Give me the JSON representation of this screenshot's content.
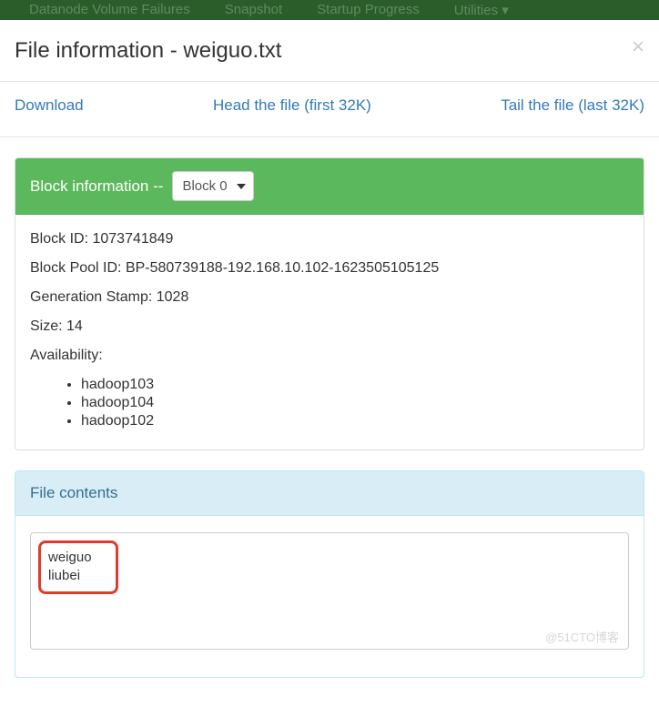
{
  "nav": {
    "items": [
      "Datanode Volume Failures",
      "Snapshot",
      "Startup Progress",
      "Utilities ▾"
    ]
  },
  "modal": {
    "title": "File information - weiguo.txt"
  },
  "actions": {
    "download": "Download",
    "head": "Head the file (first 32K)",
    "tail": "Tail the file (last 32K)"
  },
  "block_panel": {
    "heading": "Block information -- ",
    "selected": "Block 0",
    "block_id_label": "Block ID: ",
    "block_id": "1073741849",
    "pool_label": "Block Pool ID: ",
    "pool_id": "BP-580739188-192.168.10.102-1623505105125",
    "genstamp_label": "Generation Stamp: ",
    "genstamp": "1028",
    "size_label": "Size: ",
    "size": "14",
    "availability_label": "Availability:",
    "availability": [
      "hadoop103",
      "hadoop104",
      "hadoop102"
    ]
  },
  "contents_panel": {
    "heading": "File contents",
    "lines": [
      "weiguo",
      "liubei"
    ]
  },
  "watermark": "@51CTO博客"
}
